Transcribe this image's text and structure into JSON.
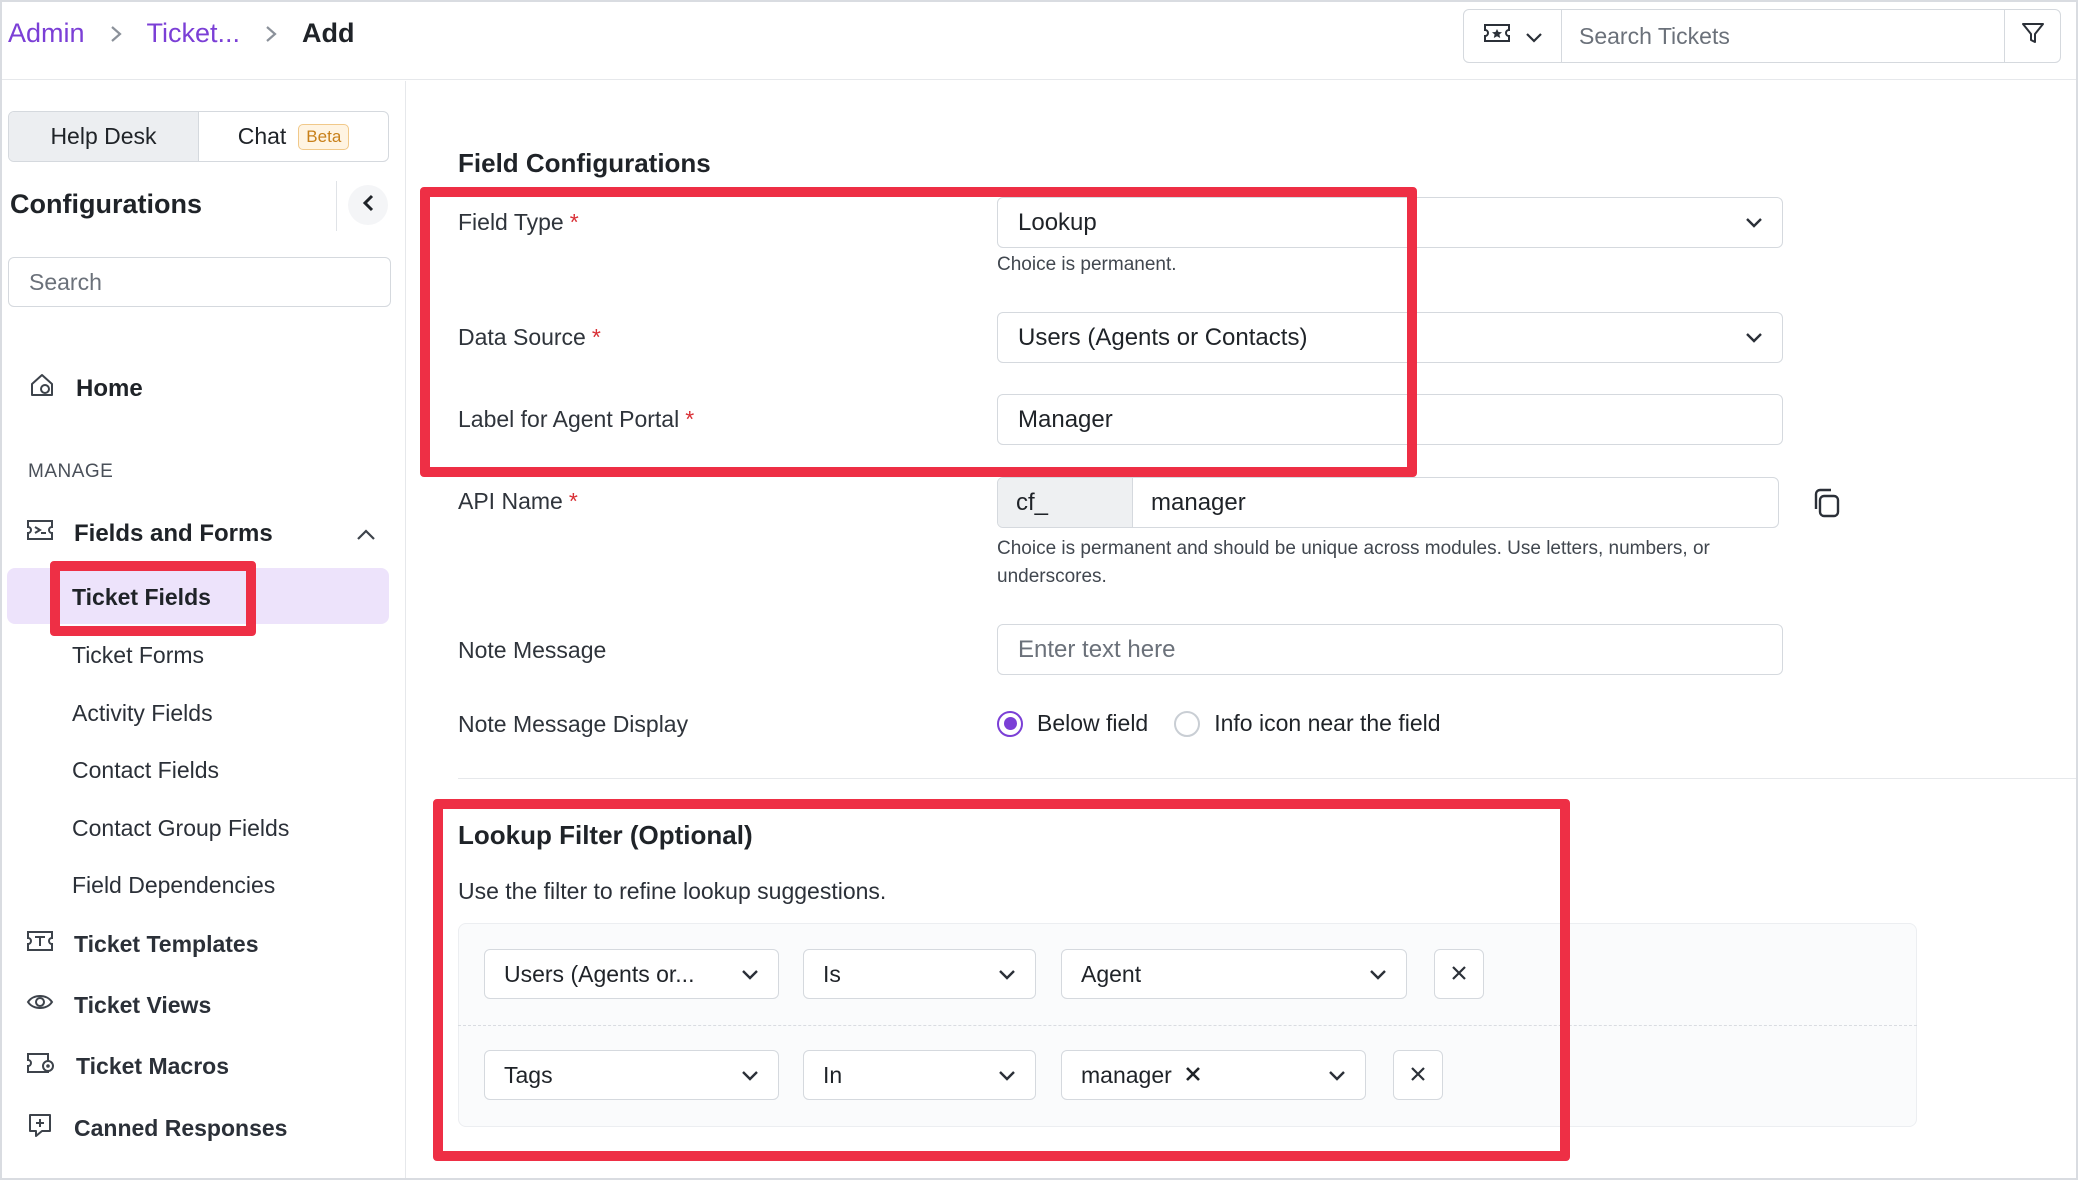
{
  "breadcrumb": {
    "root": "Admin",
    "middle": "Ticket...",
    "current": "Add"
  },
  "topbar": {
    "search_placeholder": "Search Tickets",
    "ticket_icon": "ticket-icon",
    "filter_icon": "filter-icon"
  },
  "sidebar": {
    "toggle": {
      "helpdesk": "Help Desk",
      "chat": "Chat",
      "beta": "Beta"
    },
    "title": "Configurations",
    "search_placeholder": "Search",
    "home": "Home",
    "manage": "MANAGE",
    "fields_and_forms": "Fields and Forms",
    "sub_items": [
      "Ticket Fields",
      "Ticket Forms",
      "Activity Fields",
      "Contact Fields",
      "Contact Group Fields",
      "Field Dependencies"
    ],
    "items": [
      "Ticket Templates",
      "Ticket Views",
      "Ticket Macros",
      "Canned Responses"
    ]
  },
  "main": {
    "section_title": "Field Configurations",
    "field_type": {
      "label": "Field Type",
      "value": "Lookup",
      "helper": "Choice is permanent."
    },
    "data_source": {
      "label": "Data Source",
      "value": "Users (Agents or Contacts)"
    },
    "label_agent": {
      "label": "Label for Agent Portal",
      "value": "Manager"
    },
    "api_name": {
      "label": "API Name",
      "prefix": "cf_",
      "value": "manager",
      "helper_line1": "Choice is permanent and should be unique across modules. Use letters, numbers, or",
      "helper_line2": "underscores."
    },
    "note_message": {
      "label": "Note Message",
      "placeholder": "Enter text here"
    },
    "note_display": {
      "label": "Note Message Display",
      "option1": "Below field",
      "option2": "Info icon near the field",
      "selected": "Below field"
    },
    "required_mark": "*"
  },
  "lookup": {
    "title": "Lookup Filter (Optional)",
    "description": "Use the filter to refine lookup suggestions.",
    "rows": [
      {
        "field": "Users (Agents or...",
        "operator": "Is",
        "value": "Agent"
      },
      {
        "field": "Tags",
        "operator": "In",
        "value": "manager"
      }
    ]
  },
  "colors": {
    "accent": "#7b3fd6",
    "annotation": "#ee2f45",
    "required": "#d93036"
  }
}
